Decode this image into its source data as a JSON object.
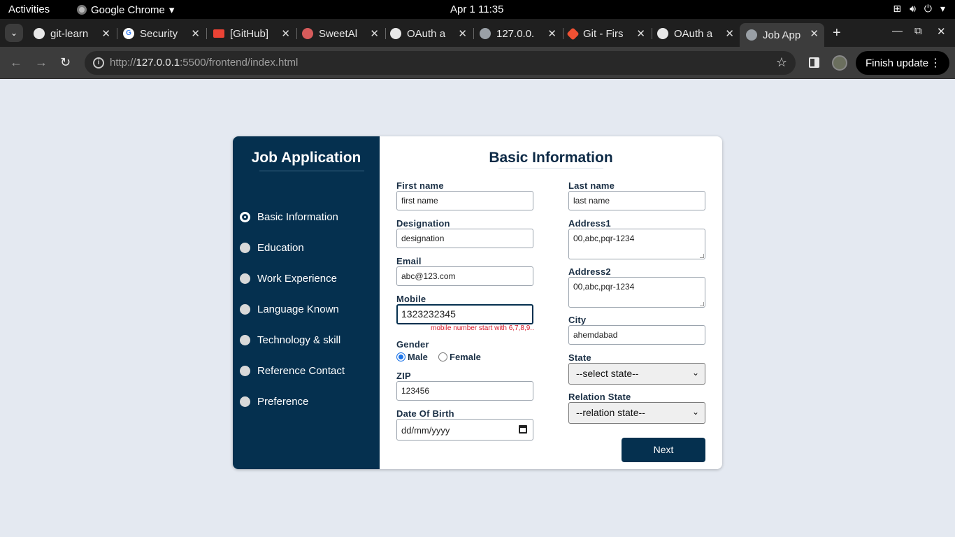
{
  "os": {
    "activities": "Activities",
    "app_name": "Google Chrome",
    "clock": "Apr 1  11:35"
  },
  "browser": {
    "tabs": [
      {
        "label": "git-learn",
        "icon": "github-icon"
      },
      {
        "label": "Security",
        "icon": "google-icon"
      },
      {
        "label": "[GitHub]",
        "icon": "gmail-icon"
      },
      {
        "label": "SweetAl",
        "icon": "sweetalert-icon"
      },
      {
        "label": "OAuth a",
        "icon": "github-icon"
      },
      {
        "label": "127.0.0.",
        "icon": "globe-icon"
      },
      {
        "label": "Git - Firs",
        "icon": "git-icon"
      },
      {
        "label": "OAuth a",
        "icon": "github-icon"
      },
      {
        "label": "Job App",
        "icon": "globe-icon",
        "active": true
      }
    ],
    "url_prefix": "http://",
    "url_host": "127.0.0.1",
    "url_rest": ":5500/frontend/index.html",
    "finish_update": "Finish update"
  },
  "sidebar": {
    "title": "Job Application",
    "steps": [
      {
        "label": "Basic Information",
        "current": true
      },
      {
        "label": "Education"
      },
      {
        "label": "Work Experience"
      },
      {
        "label": "Language Known"
      },
      {
        "label": "Technology & skill"
      },
      {
        "label": "Reference Contact"
      },
      {
        "label": "Preference"
      }
    ]
  },
  "form": {
    "title": "Basic Information",
    "first_name": {
      "label": "First name",
      "value": "first name"
    },
    "last_name": {
      "label": "Last name",
      "value": "last name"
    },
    "designation": {
      "label": "Designation",
      "value": "designation"
    },
    "address1": {
      "label": "Address1",
      "value": "00,abc,pqr-1234"
    },
    "email": {
      "label": "Email",
      "value": "abc@123.com"
    },
    "address2": {
      "label": "Address2",
      "value": "00,abc,pqr-1234"
    },
    "mobile": {
      "label": "Mobile",
      "value": "1323232345",
      "error": "mobile number start with 6,7,8,9.."
    },
    "city": {
      "label": "City",
      "value": "ahemdabad"
    },
    "gender": {
      "label": "Gender",
      "options": [
        "Male",
        "Female"
      ],
      "selected": "Male"
    },
    "state": {
      "label": "State",
      "value": "--select state--"
    },
    "zip": {
      "label": "ZIP",
      "value": "123456"
    },
    "relation_state": {
      "label": "Relation State",
      "value": "--relation state--"
    },
    "dob": {
      "label": "Date Of Birth",
      "placeholder": "dd/mm/yyyy"
    },
    "next_label": "Next"
  },
  "colors": {
    "sidebar_bg": "#05304f",
    "page_bg": "#e4e9f1",
    "error": "#d81b2c"
  }
}
